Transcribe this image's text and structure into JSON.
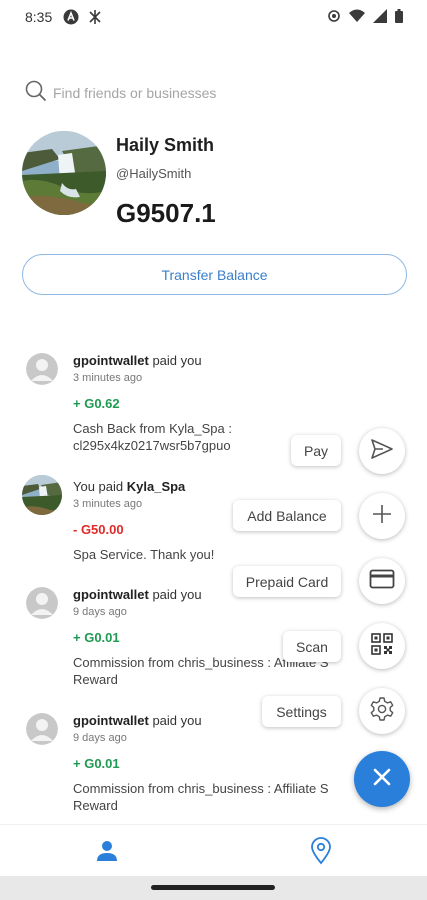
{
  "status_bar": {
    "time": "8:35",
    "left_icons": [
      "a-circle-icon",
      "sync-icon"
    ],
    "right_icons": [
      "eye-icon",
      "wifi-icon",
      "signal-icon",
      "battery-icon"
    ]
  },
  "search": {
    "placeholder": "Find friends or businesses",
    "icon": "search-icon"
  },
  "profile": {
    "name": "Haily Smith",
    "handle": "@HailySmith",
    "balance": "G9507.1",
    "avatar": "waterfall-photo"
  },
  "transfer_button": {
    "label": "Transfer Balance"
  },
  "feed": [
    {
      "avatar": "default-user",
      "actor": "gpointwallet",
      "action": " paid you",
      "time": "3 minutes ago",
      "amount": "+ G0.62",
      "sign": "positive",
      "description": "Cash Back from Kyla_Spa :\ncl295x4kz0217wsr5b7gpuo"
    },
    {
      "avatar": "waterfall-photo",
      "prefix": "You paid ",
      "actor": "Kyla_Spa",
      "time": "3 minutes ago",
      "amount": "- G50.00",
      "sign": "negative",
      "description": "Spa Service. Thank you!"
    },
    {
      "avatar": "default-user",
      "actor": "gpointwallet",
      "action": " paid you",
      "time": "9 days ago",
      "amount": "+ G0.01",
      "sign": "positive",
      "description": "Commission from chris_business : Affiliate S\nReward"
    },
    {
      "avatar": "default-user",
      "actor": "gpointwallet",
      "action": " paid you",
      "time": "9 days ago",
      "amount": "+ G0.01",
      "sign": "positive",
      "description": "Commission from chris_business : Affiliate S\nReward"
    }
  ],
  "speed_dial": {
    "actions": [
      {
        "label": "Pay",
        "icon": "send-icon"
      },
      {
        "label": "Add Balance",
        "icon": "plus-icon"
      },
      {
        "label": "Prepaid Card",
        "icon": "card-icon"
      },
      {
        "label": "Scan",
        "icon": "qr-code-icon"
      },
      {
        "label": "Settings",
        "icon": "gear-icon"
      }
    ],
    "main_icon": "close-icon"
  },
  "bottom_nav": {
    "items": [
      {
        "icon": "person-icon",
        "active": true
      },
      {
        "icon": "location-pin-icon",
        "active": false
      }
    ]
  },
  "colors": {
    "accent": "#2a7fdb",
    "positive": "#1f9a52",
    "negative": "#e02b2b",
    "button_border": "#8fb8e3"
  }
}
